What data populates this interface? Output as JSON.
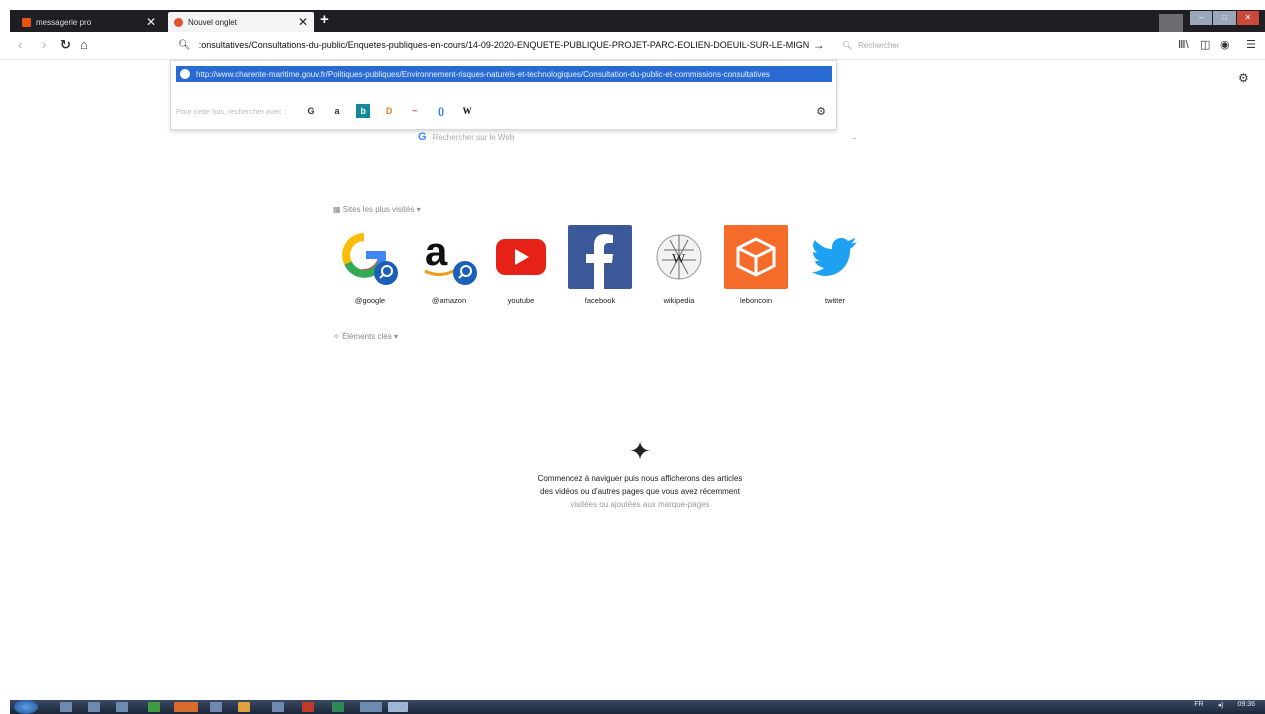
{
  "tabs": [
    {
      "title": "messagerie pro",
      "favicon_color": "#e8520e"
    },
    {
      "title": "Nouvel onglet",
      "favicon_color": "#e0502a"
    }
  ],
  "nav": {
    "back_icon": "arrow-left-icon",
    "forward_icon": "arrow-right-icon",
    "reload_icon": "reload-icon",
    "home_icon": "home-icon"
  },
  "urlbar": {
    "value": ":onsultatives/Consultations-du-public/Enquetes-publiques-en-cours/14-09-2020-ENQUETE-PUBLIQUE-PROJET-PARC-EOLIEN-DOEUIL-SUR-LE-MIGNON",
    "go": "→"
  },
  "searchbar": {
    "placeholder": "Rechercher"
  },
  "suggestion": {
    "url": "http://www.charente-maritime.gouv.fr/Politiques-publiques/Environnement-risques-naturels-et-technologiques/Consultation-du-public-et-commissions-consultatives"
  },
  "engines": {
    "label": "Pour cette fois, rechercher avec :",
    "items": [
      "G",
      "a",
      "b",
      "D",
      "~",
      "()",
      "W"
    ]
  },
  "web_search": {
    "g": "G",
    "placeholder": "Rechercher sur le Web"
  },
  "top_sites": {
    "header": "Sites les plus visités",
    "items": [
      {
        "label": "@google"
      },
      {
        "label": "@amazon"
      },
      {
        "label": "youtube"
      },
      {
        "label": "facebook"
      },
      {
        "label": "wikipedia"
      },
      {
        "label": "leboncoin"
      },
      {
        "label": "twitter"
      }
    ]
  },
  "highlights": {
    "header": "Éléments clés"
  },
  "empty_state": {
    "line1": "Commencez à naviguer puis nous afficherons des articles",
    "line2": "des vidéos ou d'autres pages que vous avez récemment",
    "line3": "visitées ou ajoutées aux marque-pages"
  },
  "tray": {
    "lang": "FR",
    "time": "09:36"
  },
  "colors": {
    "accent": "#2a6bd3",
    "tabstrip": "#1f1f23"
  }
}
